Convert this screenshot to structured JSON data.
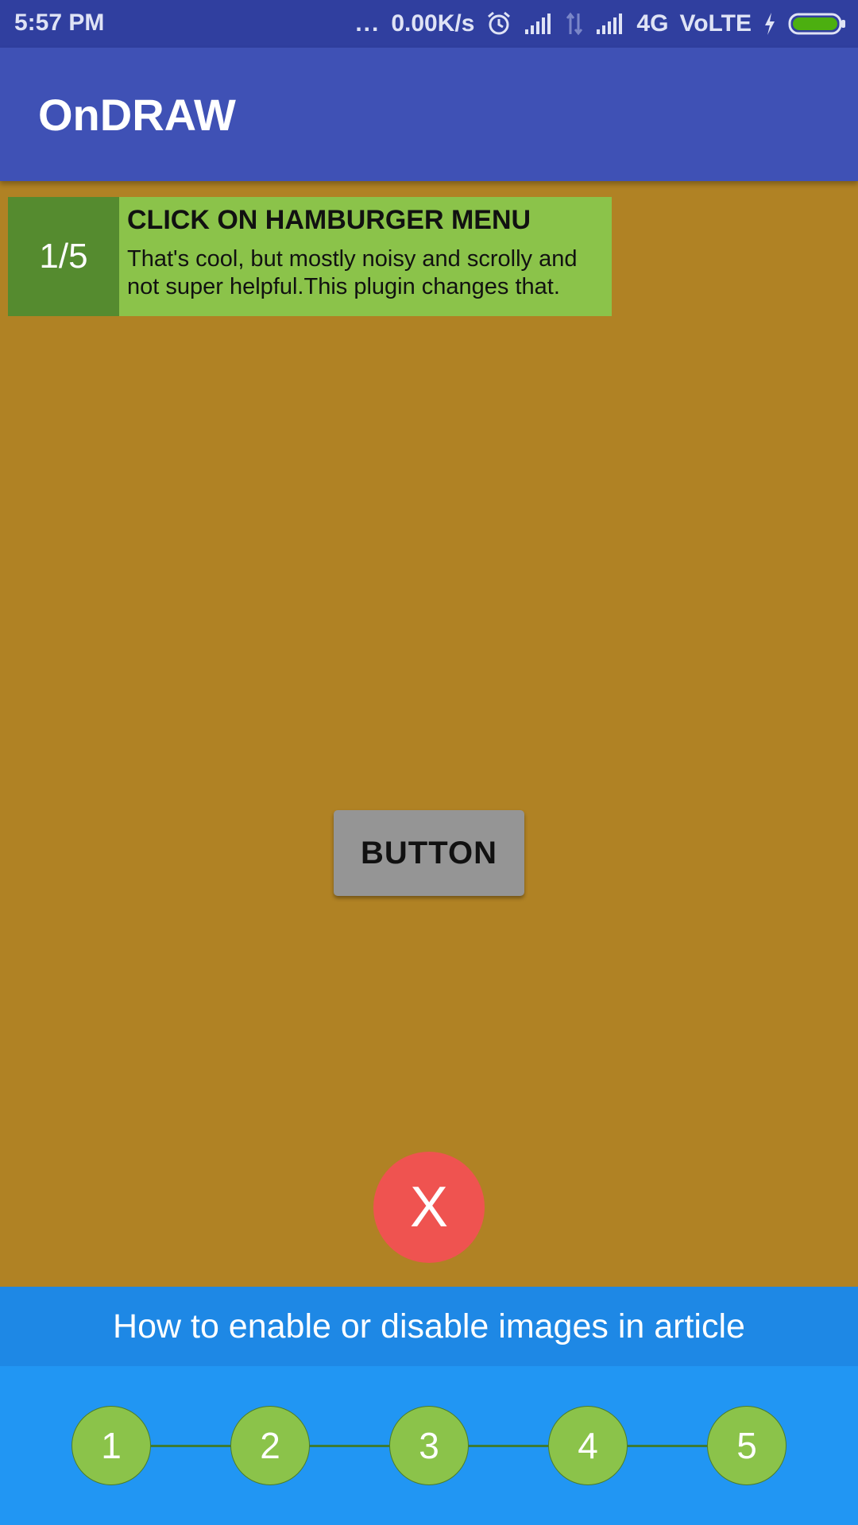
{
  "status_bar": {
    "time": "5:57 PM",
    "speed": "0.00K/s",
    "network_type": "4G",
    "volte": "VoLTE",
    "dots": "...",
    "battery_color": "#4caf10"
  },
  "app_bar": {
    "title": "OnDRAW",
    "color": "#3f51b5"
  },
  "tooltip": {
    "counter": "1/5",
    "heading": "CLICK ON HAMBURGER MENU",
    "description": "That's cool, but mostly noisy and scrolly and not super helpful.This plugin changes that."
  },
  "main": {
    "button_label": "BUTTON",
    "background_color": "#b08224"
  },
  "close_fab": {
    "label": "X",
    "color": "#ef5350"
  },
  "bottom": {
    "title": "How to enable or disable images in article",
    "steps": [
      "1",
      "2",
      "3",
      "4",
      "5"
    ]
  },
  "icons": [
    "alarm-icon",
    "signal-icon",
    "data-transfer-icon",
    "charging-icon",
    "battery-icon"
  ]
}
